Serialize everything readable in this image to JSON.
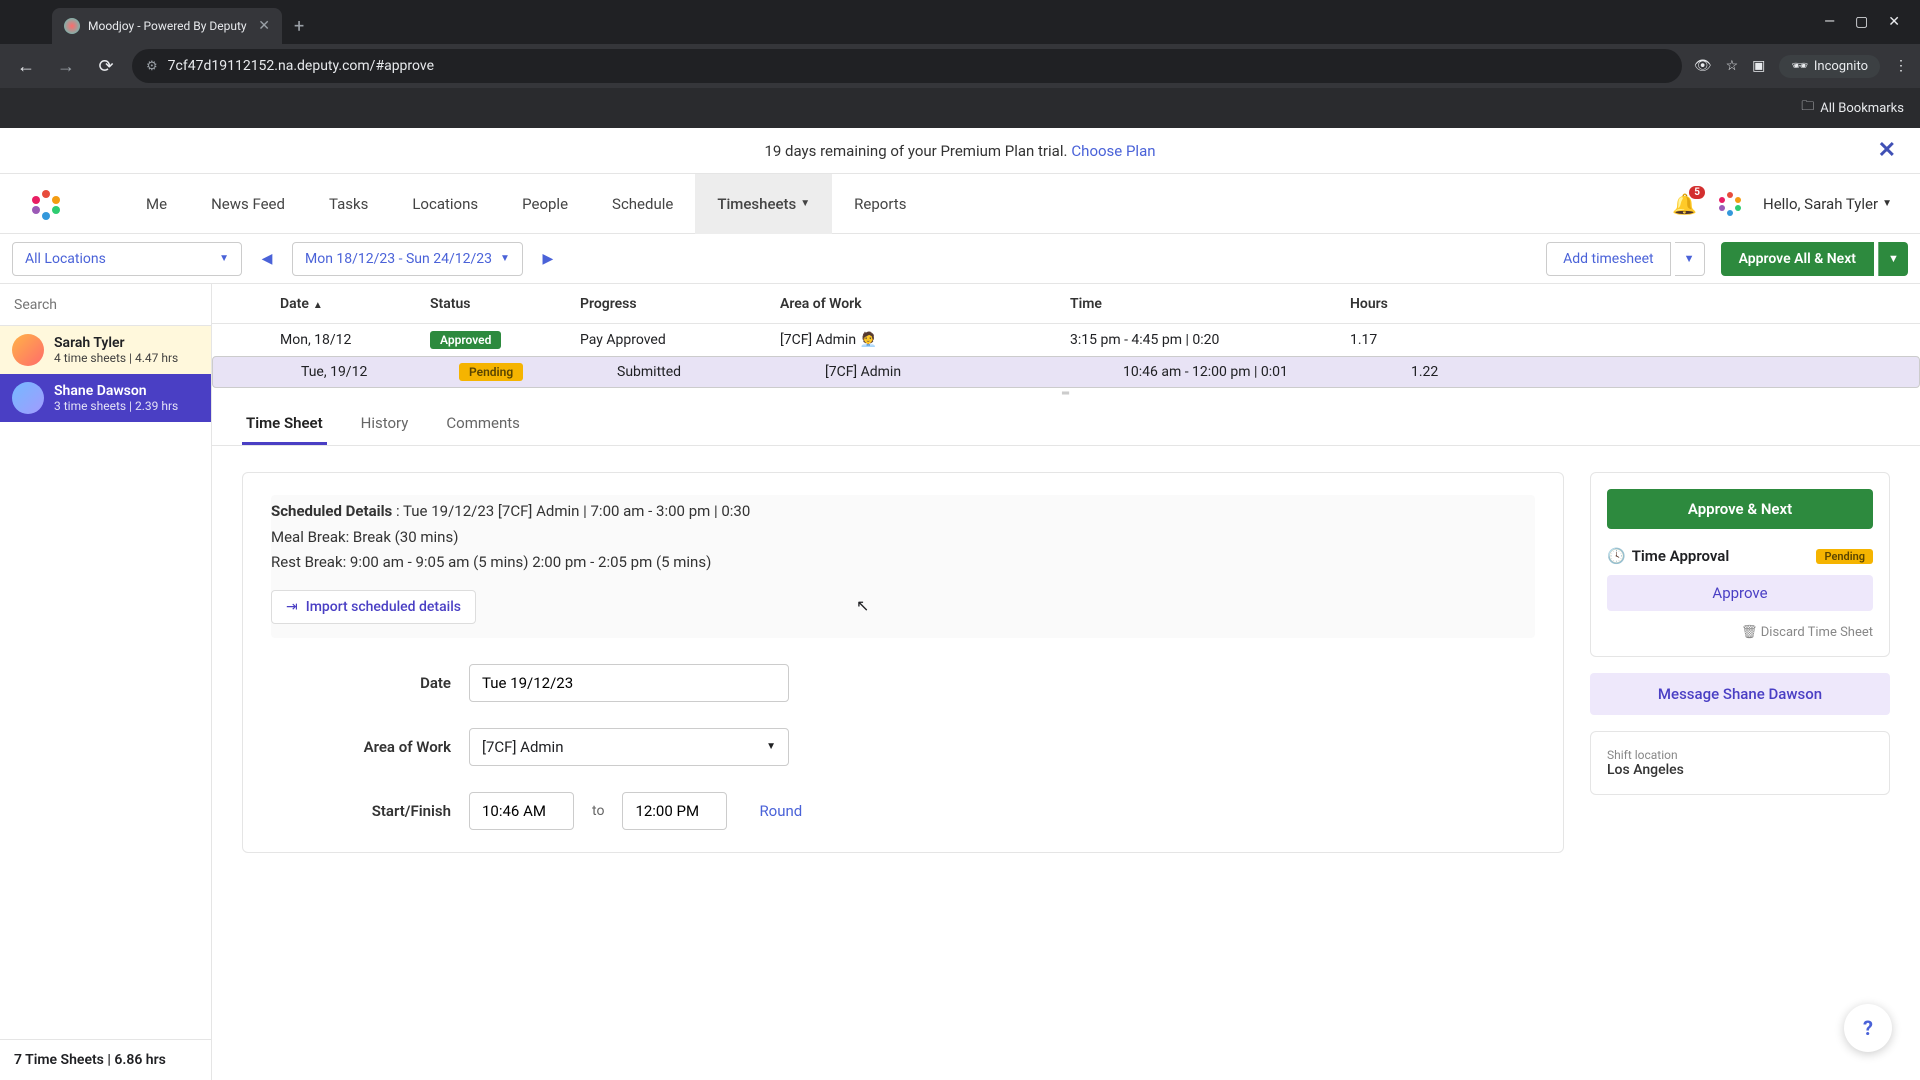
{
  "browser": {
    "tab_title": "Moodjoy - Powered By Deputy",
    "url": "7cf47d19112152.na.deputy.com/#approve",
    "incognito_label": "Incognito",
    "bookmarks_label": "All Bookmarks"
  },
  "banner": {
    "text": "19 days remaining of your Premium Plan trial.",
    "link": "Choose Plan"
  },
  "nav": {
    "items": [
      "Me",
      "News Feed",
      "Tasks",
      "Locations",
      "People",
      "Schedule",
      "Timesheets",
      "Reports"
    ],
    "active_index": 6,
    "notif_count": "5",
    "greeting": "Hello, Sarah Tyler"
  },
  "toolbar": {
    "location": "All Locations",
    "range": "Mon 18/12/23 - Sun 24/12/23",
    "add_label": "Add timesheet",
    "approve_all_label": "Approve All & Next"
  },
  "grid": {
    "headers": [
      "",
      "Date",
      "Status",
      "Progress",
      "Area of Work",
      "Time",
      "Hours"
    ],
    "rows": [
      {
        "date": "Mon, 18/12",
        "status": "Approved",
        "status_class": "approved",
        "progress": "Pay Approved",
        "area": "[7CF] Admin 🧑‍💼",
        "time": "3:15 pm - 4:45 pm | 0:20",
        "hours": "1.17"
      },
      {
        "date": "Tue, 19/12",
        "status": "Pending",
        "status_class": "pending",
        "progress": "Submitted",
        "area": "[7CF] Admin",
        "time": "10:46 am - 12:00 pm | 0:01",
        "hours": "1.22"
      }
    ]
  },
  "sidebar": {
    "search_placeholder": "Search",
    "employees": [
      {
        "name": "Sarah Tyler",
        "sub": "4 time sheets | 4.47 hrs"
      },
      {
        "name": "Shane Dawson",
        "sub": "3 time sheets | 2.39 hrs"
      }
    ],
    "footer": "7 Time Sheets | 6.86 hrs"
  },
  "tabs": {
    "items": [
      "Time Sheet",
      "History",
      "Comments"
    ],
    "active_index": 0
  },
  "detail": {
    "sched_label": "Scheduled Details",
    "sched_text": " : Tue 19/12/23 [7CF] Admin | 7:00 am - 3:00 pm | 0:30",
    "meal": "Meal Break: Break (30 mins)",
    "rest": "Rest Break: 9:00 am - 9:05 am (5 mins) 2:00 pm - 2:05 pm (5 mins)",
    "import_label": "Import scheduled details",
    "date_label": "Date",
    "date_value": "Tue 19/12/23",
    "area_label": "Area of Work",
    "area_value": "[7CF] Admin",
    "startfinish_label": "Start/Finish",
    "start_value": "10:46 AM",
    "to_label": "to",
    "finish_value": "12:00 PM",
    "round_label": "Round"
  },
  "right": {
    "approve_next": "Approve & Next",
    "time_approval": "Time Approval",
    "pending": "Pending",
    "approve": "Approve",
    "discard": "Discard Time Sheet",
    "message": "Message Shane Dawson",
    "shift_loc_label": "Shift location",
    "shift_loc_value": "Los Angeles"
  }
}
